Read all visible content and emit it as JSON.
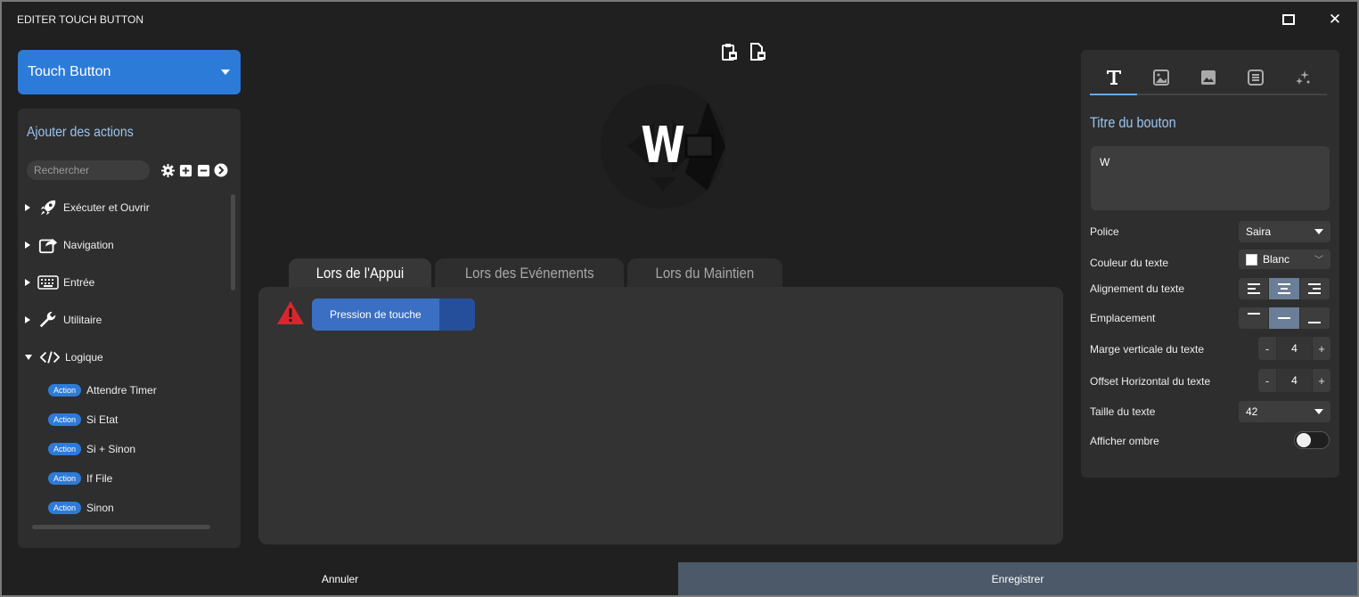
{
  "window": {
    "title": "EDITER TOUCH BUTTON"
  },
  "left": {
    "dropdown_label": "Touch Button",
    "panel_title": "Ajouter des actions",
    "search_placeholder": "Rechercher",
    "categories": [
      {
        "label": "Exécuter et Ouvrir",
        "icon": "rocket-icon",
        "expanded": false
      },
      {
        "label": "Navigation",
        "icon": "share-icon",
        "expanded": false
      },
      {
        "label": "Entrée",
        "icon": "keyboard-icon",
        "expanded": false
      },
      {
        "label": "Utilitaire",
        "icon": "wrench-icon",
        "expanded": false
      },
      {
        "label": "Logique",
        "icon": "code-icon",
        "expanded": true
      }
    ],
    "actions": [
      {
        "badge": "Action",
        "label": "Attendre Timer"
      },
      {
        "badge": "Action",
        "label": "Si Etat"
      },
      {
        "badge": "Action",
        "label": "Si + Sinon"
      },
      {
        "badge": "Action",
        "label": "If File"
      },
      {
        "badge": "Action",
        "label": "Sinon"
      }
    ]
  },
  "center": {
    "preview_letter": "W",
    "tabs": [
      {
        "label": "Lors de l'Appui",
        "active": true
      },
      {
        "label": "Lors des Evénements",
        "active": false
      },
      {
        "label": "Lors du Maintien",
        "active": false
      }
    ],
    "action_item": "Pression de touche"
  },
  "right": {
    "section_title": "Titre du bouton",
    "title_text": "W",
    "font_label": "Police",
    "font_value": "Saira",
    "color_label": "Couleur du texte",
    "color_value": "Blanc",
    "align_label": "Alignement du texte",
    "align_selected": "center",
    "placement_label": "Emplacement",
    "placement_selected": "middle",
    "vmargin_label": "Marge verticale du texte",
    "vmargin_value": "4",
    "hoffset_label": "Offset Horizontal du texte",
    "hoffset_value": "4",
    "size_label": "Taille du texte",
    "size_value": "42",
    "shadow_label": "Afficher ombre",
    "shadow_on": false,
    "minus": "-",
    "plus": "+"
  },
  "footer": {
    "cancel": "Annuler",
    "save": "Enregistrer"
  },
  "colors": {
    "accent": "#2d7bd9",
    "save_bg": "#4b5969",
    "warning": "#d9262c",
    "title_blue": "#9ac5f0"
  }
}
